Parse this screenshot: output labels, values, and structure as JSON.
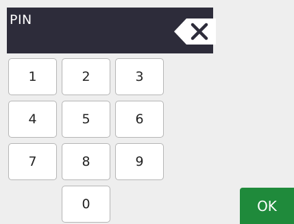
{
  "pin_field": {
    "label": "PIN",
    "value": ""
  },
  "backspace": {
    "icon": "backspace-icon"
  },
  "keypad": {
    "keys": [
      "1",
      "2",
      "3",
      "4",
      "5",
      "6",
      "7",
      "8",
      "9",
      "0"
    ]
  },
  "ok_button": {
    "label": "OK"
  },
  "colors": {
    "background": "#eeeeee",
    "pin_bar": "#2d2c3a",
    "ok_button": "#1f8a3b",
    "key_border": "#b4b4b4"
  }
}
